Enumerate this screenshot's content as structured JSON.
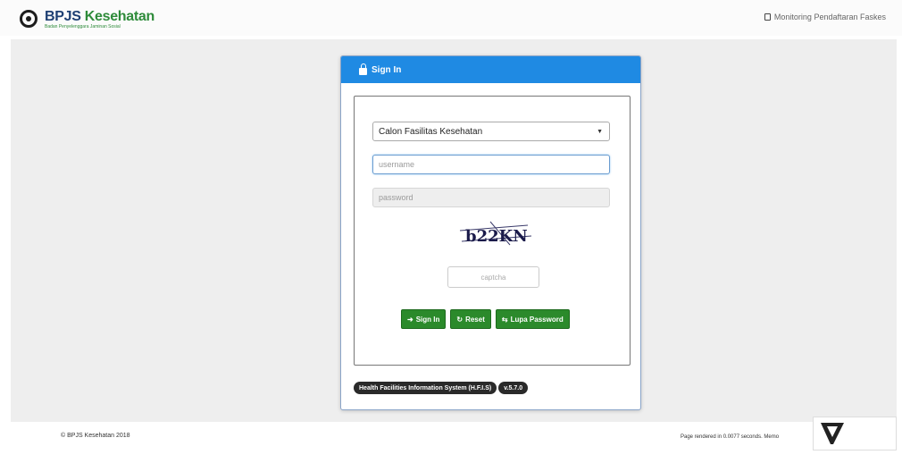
{
  "header": {
    "brand_prefix": "BPJS ",
    "brand_suffix": "Kesehatan",
    "brand_sub": "Badan Penyelenggara Jaminan Sosial",
    "monitor_link": "Monitoring Pendaftaran Faskes"
  },
  "panel": {
    "title": "Sign In"
  },
  "form": {
    "select_value": "Calon Fasilitas Kesehatan",
    "username_placeholder": "username",
    "password_placeholder": "password",
    "captcha_text": "b22KN",
    "captcha_placeholder": "captcha"
  },
  "buttons": {
    "sign_in": "Sign In",
    "reset": "Reset",
    "forgot": "Lupa Password"
  },
  "badges": {
    "system": "Health Facilities Information System (H.F.I.S)",
    "version": "v.5.7.0"
  },
  "footer": {
    "copyright": "© BPJS Kesehatan 2018",
    "render_info": "Page rendered in 0.0077 seconds. Memo"
  },
  "icons": [
    "logo-mark-icon",
    "monitor-icon",
    "lock-icon",
    "caret-down-icon",
    "sign-in-icon",
    "reset-icon",
    "transfer-icon"
  ]
}
